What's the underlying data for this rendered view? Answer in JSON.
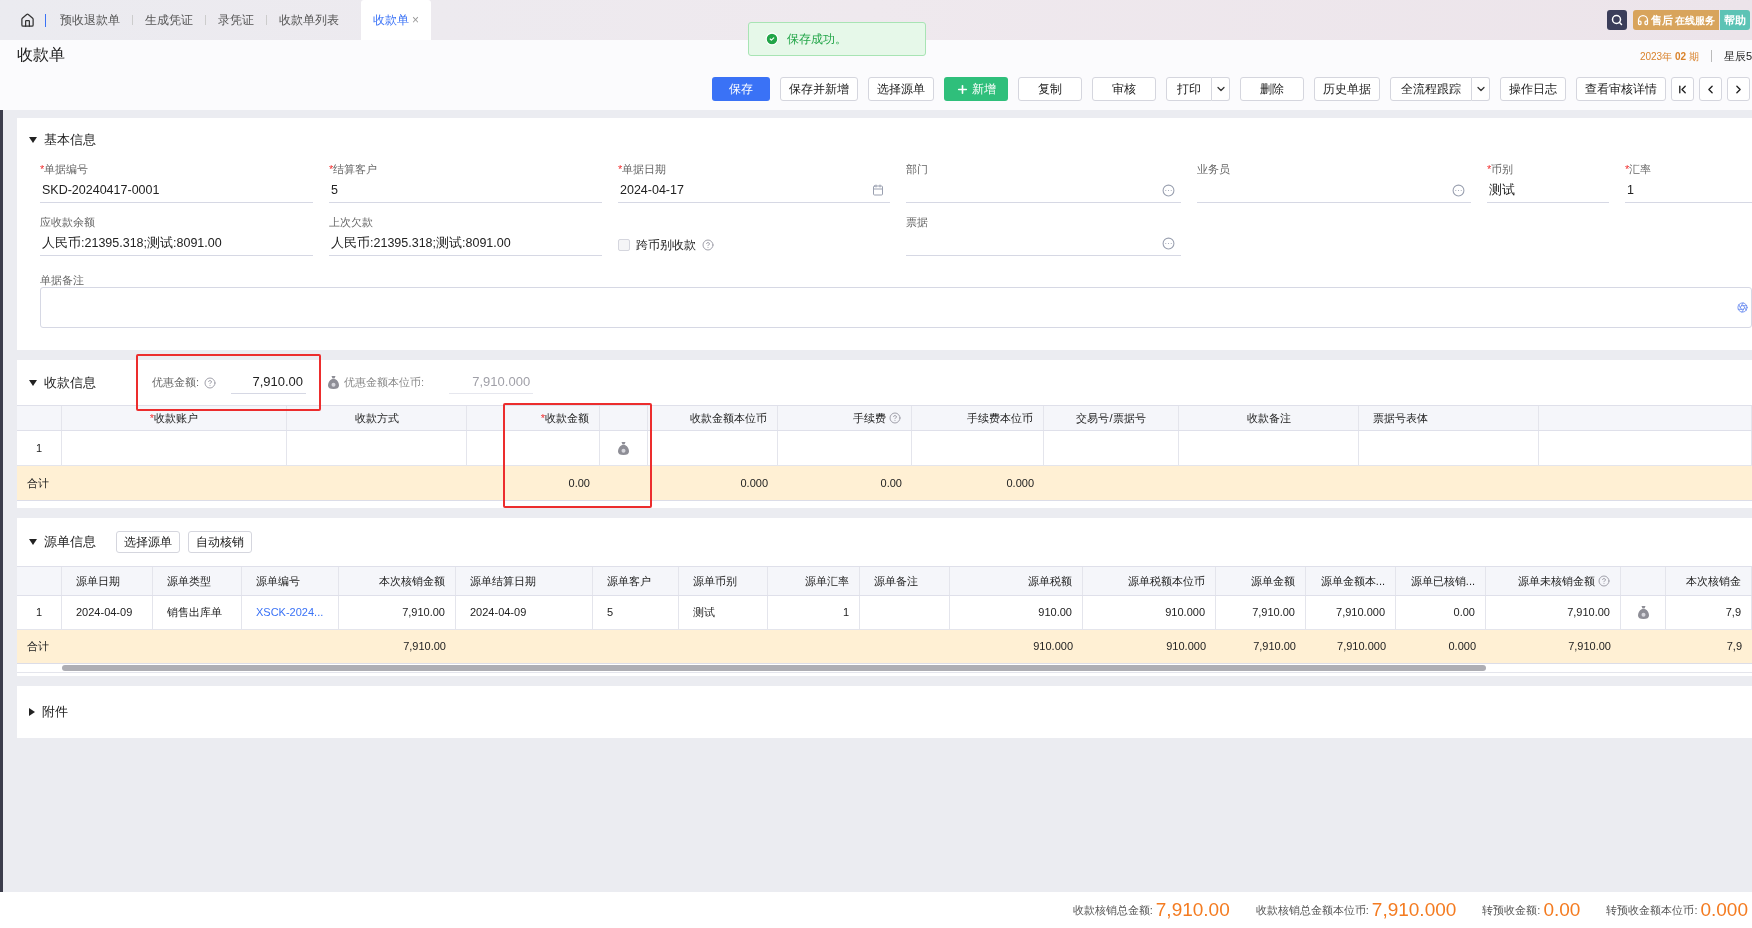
{
  "required_mark": "*",
  "tabs": [
    {
      "label": "预收退款单",
      "selected": false
    },
    {
      "label": "生成凭证",
      "selected": false
    },
    {
      "label": "录凭证",
      "selected": false
    },
    {
      "label": "收款单列表",
      "selected": false
    },
    {
      "label": "收款单",
      "selected": true,
      "close": "×"
    }
  ],
  "toast": {
    "text": "保存成功。"
  },
  "service": {
    "main": "售后",
    "sub": "在线服务"
  },
  "help": "帮助",
  "page": {
    "title": "收款单",
    "period": "2023年 **02** 期",
    "account": "星辰5"
  },
  "toolbar": [
    {
      "label": "保存",
      "kind": "primary"
    },
    {
      "label": "保存并新增",
      "kind": "default"
    },
    {
      "label": "选择源单",
      "kind": "default"
    },
    {
      "label": "新增",
      "kind": "add"
    },
    {
      "label": "复制",
      "kind": "default"
    },
    {
      "label": "审核",
      "kind": "default"
    },
    {
      "label": "打印",
      "kind": "split"
    },
    {
      "label": "删除",
      "kind": "default"
    },
    {
      "label": "历史单据",
      "kind": "default"
    },
    {
      "label": "全流程跟踪",
      "kind": "split"
    },
    {
      "label": "操作日志",
      "kind": "default"
    },
    {
      "label": "查看审核详情",
      "kind": "default"
    },
    {
      "kind": "first"
    },
    {
      "kind": "prev"
    },
    {
      "kind": "next"
    }
  ],
  "basic_info": {
    "title": "基本信息",
    "expanded": true,
    "rows": [
      [
        {
          "label": "单据编号",
          "required": true,
          "value": "SKD-20240417-0001",
          "kind": "text"
        },
        {
          "label": "结算客户",
          "required": true,
          "value": "5",
          "kind": "text"
        },
        {
          "label": "单据日期",
          "required": true,
          "value": "2024-04-17",
          "kind": "date"
        },
        {
          "label": "部门",
          "required": false,
          "kind": "lookup"
        },
        {
          "label": "业务员",
          "required": false,
          "kind": "lookup"
        },
        {
          "label": "币别",
          "required": true,
          "value": "测试",
          "kind": "text"
        },
        {
          "label": "汇率",
          "required": true,
          "value": "1",
          "kind": "text"
        }
      ],
      [
        {
          "label": "应收款余额",
          "required": false,
          "value": "人民币:21395.318;测试:8091.00",
          "kind": "text"
        },
        {
          "label": "上次欠款",
          "required": false,
          "value": "人民币:21395.318;测试:8091.00",
          "kind": "text"
        },
        {
          "label": "跨币别收款",
          "required": false,
          "checked": false,
          "kind": "checkbox"
        },
        {
          "label": "票据",
          "required": false,
          "kind": "lookup"
        }
      ]
    ],
    "remark": {
      "label": "单据备注"
    }
  },
  "payment_info": {
    "title": "收款信息",
    "expanded": true,
    "discount": {
      "label": "优惠金额:",
      "value": "7,910.00",
      "highlighted": true
    },
    "discount_base": {
      "label": "优惠金额本位币:",
      "value": "7,910.000"
    },
    "table": {
      "columns": [
        {
          "label": "收款账户",
          "kind": "text",
          "required": true,
          "help": false
        },
        {
          "label": "收款方式",
          "kind": "text",
          "required": false,
          "help": false
        },
        {
          "label": "收款金额",
          "kind": "text",
          "required": true,
          "help": false,
          "highlighted": true
        },
        {
          "kind": "icon"
        },
        {
          "label": "收款金额本位币",
          "kind": "text",
          "required": false,
          "help": false
        },
        {
          "label": "手续费",
          "kind": "text",
          "required": false,
          "help": true
        },
        {
          "label": "手续费本位币",
          "kind": "text",
          "required": false,
          "help": false
        },
        {
          "label": "交易号/票据号",
          "kind": "text",
          "required": false,
          "help": false
        },
        {
          "label": "收款备注",
          "kind": "text",
          "required": false,
          "help": false
        },
        {
          "label": "票据号表体",
          "kind": "text",
          "required": false,
          "help": false
        },
        {
          "kind": "blank"
        }
      ],
      "rows": [
        {
          "index": "1"
        }
      ],
      "total": {
        "label": "合计",
        "cells": [
          null,
          null,
          "0.00",
          null,
          "0.000",
          "0.00",
          "0.000",
          null,
          null,
          null,
          null
        ]
      }
    }
  },
  "source_info": {
    "title": "源单信息",
    "expanded": true,
    "buttons": [
      "选择源单",
      "自动核销"
    ],
    "table": {
      "columns": [
        {
          "label": "源单日期",
          "kind": "text",
          "help": false
        },
        {
          "label": "源单类型",
          "kind": "text",
          "help": false
        },
        {
          "label": "源单编号",
          "kind": "link",
          "help": false
        },
        {
          "label": "本次核销金额",
          "kind": "text",
          "help": false
        },
        {
          "label": "源单结算日期",
          "kind": "text",
          "help": false
        },
        {
          "label": "源单客户",
          "kind": "text",
          "help": false
        },
        {
          "label": "源单币别",
          "kind": "text",
          "help": false
        },
        {
          "label": "源单汇率",
          "kind": "text",
          "help": false
        },
        {
          "label": "源单备注",
          "kind": "text",
          "help": false
        },
        {
          "label": "源单税额",
          "kind": "text",
          "help": false
        },
        {
          "label": "源单税额本位币",
          "kind": "text",
          "help": false
        },
        {
          "label": "源单金额",
          "kind": "text",
          "help": false
        },
        {
          "label": "源单金额本...",
          "kind": "text",
          "help": false
        },
        {
          "label": "源单已核销...",
          "kind": "text",
          "help": false
        },
        {
          "label": "源单未核销金额",
          "kind": "text",
          "help": true
        },
        {
          "kind": "icon",
          "help": false
        },
        {
          "label": "本次核销金",
          "kind": "text",
          "help": false
        }
      ],
      "rows": [
        {
          "index": "1",
          "cells": [
            "2024-04-09",
            "销售出库单",
            "XSCK-2024...",
            "7,910.00",
            "2024-04-09",
            "5",
            "测试",
            "1",
            null,
            "910.00",
            "910.000",
            "7,910.00",
            "7,910.000",
            "0.00",
            "7,910.00",
            null,
            "7,9"
          ]
        }
      ],
      "total": {
        "label": "合计",
        "cells": [
          null,
          null,
          null,
          "7,910.00",
          null,
          null,
          null,
          null,
          null,
          "910.000",
          "910.000",
          "7,910.00",
          "7,910.000",
          "0.000",
          "7,910.00",
          null,
          "7,9"
        ]
      }
    }
  },
  "attachments": {
    "title": "附件",
    "expanded": false
  },
  "totals": [
    {
      "label": "收款核销总金额:",
      "value": "7,910.00"
    },
    {
      "label": "收款核销总金额本位币:",
      "value": "7,910.000"
    },
    {
      "label": "转预收金额:",
      "value": "0.00"
    },
    {
      "label": "转预收金额本位币:",
      "value": "0.000"
    }
  ]
}
